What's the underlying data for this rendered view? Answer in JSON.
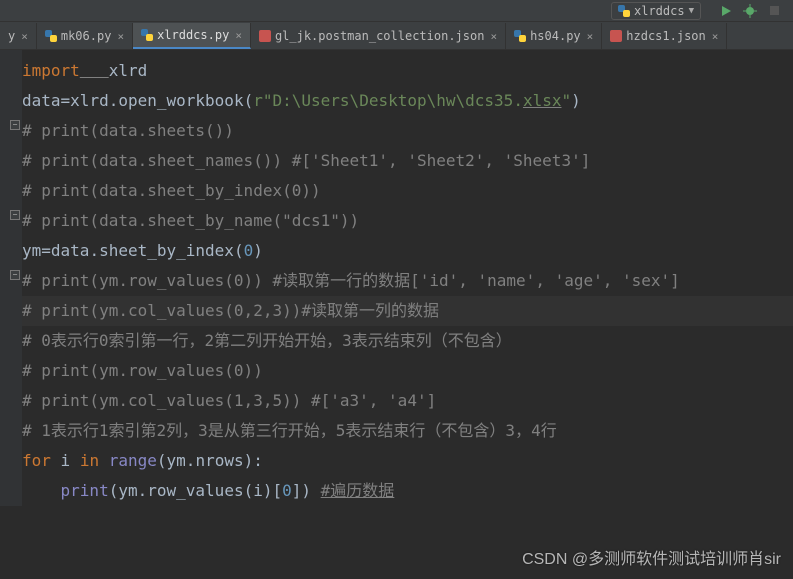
{
  "toolbar": {
    "run_config_label": "xlrddcs",
    "run_icon": "play-icon",
    "debug_icon": "bug-icon",
    "stop_icon": "stop-icon"
  },
  "tabs": [
    {
      "label": "y",
      "icon": "python",
      "active": false,
      "truncated": true
    },
    {
      "label": "mk06.py",
      "icon": "python",
      "active": false
    },
    {
      "label": "xlrddcs.py",
      "icon": "python",
      "active": true
    },
    {
      "label": "gl_jk.postman_collection.json",
      "icon": "json",
      "active": false
    },
    {
      "label": "hs04.py",
      "icon": "python",
      "active": false
    },
    {
      "label": "hzdcs1.json",
      "icon": "json",
      "active": false
    }
  ],
  "code": {
    "l1_import": "import",
    "l1_sp": "   ",
    "l1_mod": "xlrd",
    "l2_a": "data",
    "l2_eq": "=",
    "l2_b": "xlrd",
    "l2_dot1": ".",
    "l2_fn": "open_workbook",
    "l2_op1": "(",
    "l2_r": "r",
    "l2_str1": "\"D:\\Users\\Desktop\\hw\\dcs35.",
    "l2_xlsx": "xlsx",
    "l2_str2": "\"",
    "l2_op2": ")",
    "l3": "# print(data.sheets())",
    "l4": "# print(data.sheet_names()) #['Sheet1', 'Sheet2', 'Sheet3']",
    "l5": "# print(data.sheet_by_index(0))",
    "l6": "# print(data.sheet_by_name(\"dcs1\"))",
    "l7_a": "ym",
    "l7_eq": "=",
    "l7_b": "data",
    "l7_dot": ".",
    "l7_fn": "sheet_by_index",
    "l7_op1": "(",
    "l7_num": "0",
    "l7_op2": ")",
    "l8": "# print(ym.row_values(0)) #读取第一行的数据['id', 'name', 'age', 'sex']",
    "l9": "# print(ym.col_values(0,2,3))#读取第一列的数据",
    "l10": "# 0表示行0索引第一行，2第二列开始开始，3表示结束列（不包含）",
    "l11": "# print(ym.row_values(0))",
    "l12": "# print(ym.col_values(1,3,5)) #['a3', 'a4']",
    "l13": "# 1表示行1索引第2列，3是从第三行开始，5表示结束行（不包含）3，4行",
    "l14": "",
    "l15_for": "for",
    "l15_i": " i ",
    "l15_in": "in",
    "l15_sp": " ",
    "l15_range": "range",
    "l15_op1": "(",
    "l15_ym": "ym",
    "l15_dot": ".",
    "l15_nrows": "nrows",
    "l15_op2": "):",
    "l16_indent": "    ",
    "l16_print": "print",
    "l16_op1": "(",
    "l16_ym": "ym",
    "l16_dot": ".",
    "l16_rv": "row_values",
    "l16_op2": "(",
    "l16_i": "i",
    "l16_op3": ")[",
    "l16_num": "0",
    "l16_op4": "]) ",
    "l16_cmt": "#遍历数据"
  },
  "watermark": "CSDN @多测师软件测试培训师肖sir"
}
